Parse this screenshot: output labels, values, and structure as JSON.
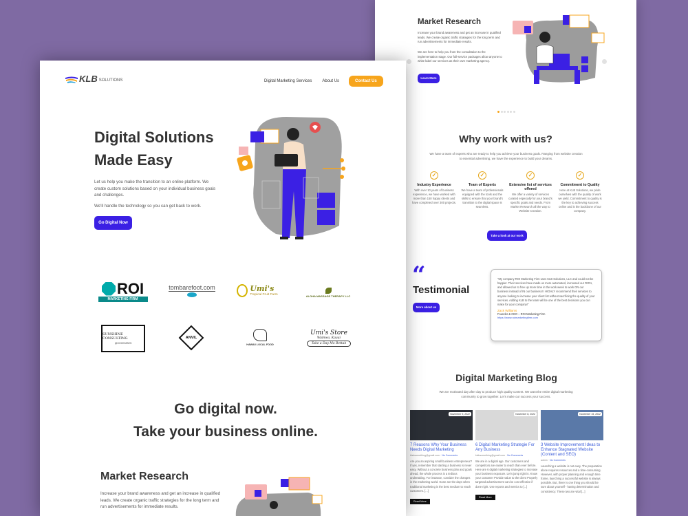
{
  "back_page": {
    "market": {
      "title": "Market Research",
      "p1": "Increase your brand awareness and get an increase in qualified leads. We create organic traffic strategies for the long term and run advertisements for immediate results.",
      "p2": "We are here to help you from the consultation to the implementation stage. Our full-service packages allow anyone to white label our services as their own marketing agency.",
      "button": "Learn More"
    },
    "why": {
      "title": "Why work with us?",
      "intro": "We have a team of experts who are ready to help you achieve your business goals. Ranging from website creation to essential advertising, we have the experience to build your dreams.",
      "columns": [
        {
          "title": "Industry Experience",
          "text": "With over 10 years of business experience, we have worked with more than 150 happy clients and have completed over 300 projects."
        },
        {
          "title": "Team of Experts",
          "text": "We have a team of professionals equipped with the tools and the skills to ensure that your brand's transition to the digital space is seamless."
        },
        {
          "title": "Extensive list of services offered",
          "text": "We offer a variety of services curated especially for your brand's specific goals and needs. From Market Research all the way to Website Creation."
        },
        {
          "title": "Commitment to Quality",
          "text": "Here at KLB Solutions, we pride ourselves with the quality of work we yield. Commitment to quality is the key to achieving success online and is the backbone of our company."
        }
      ],
      "button": "Take a look at our work"
    },
    "testimonial": {
      "title": "Testimonial",
      "button": "More about us",
      "quote": "\"My company ROI Marketing Firm uses KLB Solutions, LLC and could not be happier. Their services have made us more automated, increased our ROI's, and allowed us to free up more time in the work week to work ON our business instead of IN our business! I HIGHLY recommend their services to anyone looking to increase your client list without sacrificing the quality of your services. Adding KLB to the team will be one of the best decisions you can make for your company!\"",
      "name": "Zack Williams",
      "role": "Founder & CEO – ROI Marketing Firm",
      "link": "https://www.roimarketingfirm.com"
    },
    "blog": {
      "title": "Digital Marketing Blog",
      "intro": "We are motivated day after day to produce high quality content. We want the entire digital marketing community to grow together. Let's make our success your success.",
      "posts": [
        {
          "date": "November 9, 2022",
          "title": "7 Reasons Why Your Business Needs Digital Marketing",
          "author": "klsbsomething@gmail.com",
          "comments": "No Comments",
          "excerpt": "Are you an aspiring small business entrepreneur? If yes, remember that starting a business is never easy. Without a concrete business plan and goals ahead, the whole process is a tedious undertaking. For instance, consider the changes in the marketing world. Gone are the days when traditional marketing is the best medium to reach customers. [...]",
          "more": "Read More"
        },
        {
          "date": "November 8, 2022",
          "title": "6 Digital Marketing Strategie For Any Business",
          "author": "klsbsomething@gmail.com",
          "comments": "No Comments",
          "excerpt": "We are in a digital age. Our customers and competitors are easier to reach than ever before. Here are 6 digital marketing strategies to increase your business exposure. Let's jump right in. Know your customer Provide value to the client Properly targeted advertisement can be cost effective if done right. Use reports and metrics to [...]",
          "more": "Read More"
        },
        {
          "date": "November 15, 2022",
          "title": "3 Website Improvement Ideas to Enhance Stagnated Website (Content and SEO)",
          "author": "admin",
          "comments": "No Comments",
          "excerpt": "Launching a website is not easy. The preparation alone requires resources and a time-consuming. However, with proper planning and enough time frame, launching a successful website is always possible. But, there is one thing you should be sure about yourself - having determination and consistency. These two are vital [...]",
          "more": ""
        }
      ]
    }
  },
  "front_page": {
    "brand": {
      "klb": "KLB",
      "solutions": "SOLUTIONS"
    },
    "nav": {
      "services": "Digital Marketing Services",
      "about": "About Us",
      "contact": "Contact Us"
    },
    "hero": {
      "title_line1": "Digital Solutions",
      "title_line2": "Made Easy",
      "p1": "Let us help you make the transition to an online platform. We create custom solutions based on your individual business goals and challenges.",
      "p2": "We'll handle the technology so you can get back to work.",
      "button": "Go Digital Now"
    },
    "clients": {
      "roi_big": "ROI",
      "roi_small": "MARKETING FIRM",
      "tombarefoot": "tombarefoot.com",
      "umis_title": "Umi's",
      "umis_sub": "Tropical Fruit Farm",
      "aloha": "ALOHA MASSAGE THERAPY LLC",
      "sunshine": "SUNSHINE CONSULTING",
      "sunshine_sub": "@GOODVIBES",
      "anvil": "ANVIL",
      "hawaii": "HAWAII LOCAL FOOD",
      "umis_store_title": "Umi's Store",
      "umis_store_sub": "Waimea, Kauai",
      "umis_store_tag": "Take a Day Mo Bettah"
    },
    "cta": {
      "line1": "Go digital now.",
      "line2": "Take your business online."
    },
    "market": {
      "title": "Market Research",
      "text": "Increase your brand awareness and get an increase in qualified leads. We create organic traffic strategies for the long term and run advertisements for immediate results."
    }
  },
  "colors": {
    "background": "#7f6aa3",
    "accent_blue": "#3b20e4",
    "accent_orange": "#f7a51c"
  }
}
